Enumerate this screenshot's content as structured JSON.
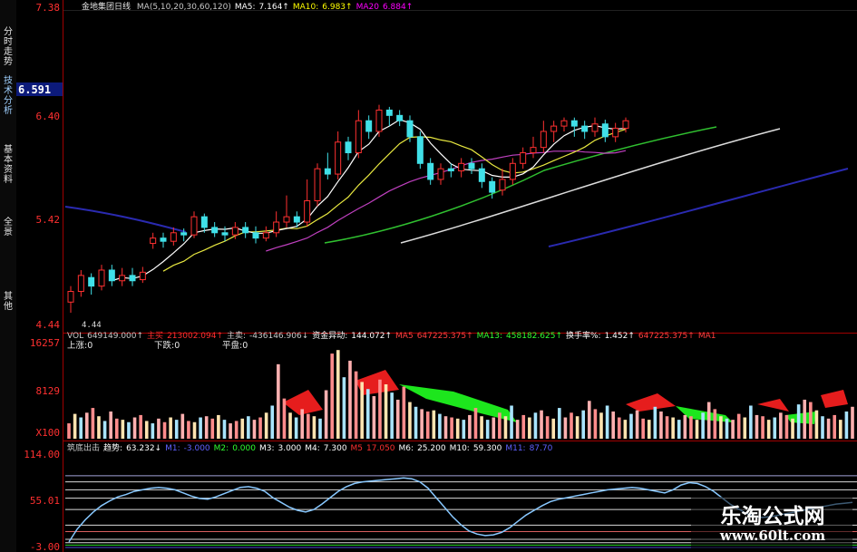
{
  "side_tabs": [
    "分时走势",
    "技术分析",
    "基本资料",
    "全景",
    "其他"
  ],
  "watermark": {
    "line1": "乐淘公式网",
    "line2": "www.60lt.com"
  },
  "chart_data": [
    {
      "type": "candlestick",
      "title": "金地集团日线",
      "legend": [
        {
          "text": "MA(5,10,20,30,60,120)",
          "color": "#c8c8c8"
        },
        {
          "text": "MA5:",
          "color": "#ffffff"
        },
        {
          "text": "7.164↑",
          "color": "#ffffff"
        },
        {
          "text": "MA10:",
          "color": "#ffff00"
        },
        {
          "text": "6.983↑",
          "color": "#ffff00"
        },
        {
          "text": "MA20",
          "color": "#ff00ff"
        },
        {
          "text": "6.884↑",
          "color": "#ff00ff"
        }
      ],
      "y_ticks": [
        "7.38",
        "6.40",
        "5.42",
        "4.44"
      ],
      "ylim": [
        4.44,
        7.38
      ],
      "current_price": "6.591",
      "low_label": "4.44",
      "candles": [
        [
          4.65,
          4.75,
          4.55,
          4.8
        ],
        [
          4.75,
          4.9,
          4.7,
          4.95
        ],
        [
          4.88,
          4.8,
          4.72,
          4.92
        ],
        [
          4.8,
          4.95,
          4.76,
          5.0
        ],
        [
          4.95,
          4.85,
          4.8,
          5.0
        ],
        [
          4.85,
          4.9,
          4.8,
          4.97
        ],
        [
          4.9,
          4.85,
          4.8,
          4.97
        ],
        [
          4.86,
          4.93,
          4.83,
          4.98
        ],
        [
          5.2,
          5.25,
          5.15,
          5.3
        ],
        [
          5.25,
          5.22,
          5.16,
          5.3
        ],
        [
          5.22,
          5.3,
          5.18,
          5.35
        ],
        [
          5.3,
          5.28,
          5.22,
          5.34
        ],
        [
          5.28,
          5.45,
          5.25,
          5.5
        ],
        [
          5.45,
          5.35,
          5.3,
          5.48
        ],
        [
          5.35,
          5.3,
          5.26,
          5.4
        ],
        [
          5.3,
          5.28,
          5.22,
          5.36
        ],
        [
          5.28,
          5.35,
          5.24,
          5.4
        ],
        [
          5.35,
          5.3,
          5.25,
          5.4
        ],
        [
          5.3,
          5.25,
          5.2,
          5.36
        ],
        [
          5.25,
          5.3,
          5.22,
          5.36
        ],
        [
          5.3,
          5.4,
          5.26,
          5.5
        ],
        [
          5.4,
          5.45,
          5.35,
          5.65
        ],
        [
          5.45,
          5.4,
          5.35,
          5.5
        ],
        [
          5.4,
          5.6,
          5.36,
          5.8
        ],
        [
          5.6,
          5.9,
          5.55,
          5.95
        ],
        [
          5.9,
          5.85,
          5.8,
          6.05
        ],
        [
          5.85,
          6.15,
          5.8,
          6.25
        ],
        [
          6.15,
          6.05,
          5.98,
          6.2
        ],
        [
          6.05,
          6.35,
          6.0,
          6.45
        ],
        [
          6.35,
          6.25,
          6.18,
          6.4
        ],
        [
          6.25,
          6.45,
          6.2,
          6.5
        ],
        [
          6.45,
          6.4,
          6.3,
          6.48
        ],
        [
          6.4,
          6.35,
          6.3,
          6.45
        ],
        [
          6.35,
          6.2,
          6.15,
          6.4
        ],
        [
          6.2,
          5.95,
          5.9,
          6.25
        ],
        [
          5.95,
          5.8,
          5.75,
          6.0
        ],
        [
          5.8,
          5.9,
          5.75,
          5.95
        ],
        [
          5.9,
          5.88,
          5.82,
          5.95
        ],
        [
          5.88,
          5.95,
          5.82,
          6.0
        ],
        [
          5.95,
          5.9,
          5.85,
          6.0
        ],
        [
          5.9,
          5.78,
          5.72,
          5.95
        ],
        [
          5.78,
          5.68,
          5.62,
          5.82
        ],
        [
          5.7,
          5.8,
          5.65,
          5.9
        ],
        [
          5.8,
          5.95,
          5.75,
          6.0
        ],
        [
          5.95,
          6.05,
          5.9,
          6.1
        ],
        [
          6.05,
          6.1,
          6.0,
          6.2
        ],
        [
          6.1,
          6.25,
          6.05,
          6.35
        ],
        [
          6.25,
          6.3,
          6.15,
          6.35
        ],
        [
          6.3,
          6.35,
          6.25,
          6.38
        ],
        [
          6.35,
          6.3,
          6.2,
          6.38
        ],
        [
          6.3,
          6.25,
          6.18,
          6.35
        ],
        [
          6.25,
          6.32,
          6.2,
          6.38
        ],
        [
          6.32,
          6.2,
          6.15,
          6.36
        ],
        [
          6.2,
          6.28,
          6.15,
          6.33
        ],
        [
          6.28,
          6.35,
          6.24,
          6.38
        ]
      ]
    },
    {
      "type": "bar",
      "legend": [
        {
          "text": "VOL",
          "color": "#c8c8c8"
        },
        {
          "text": "649149.000↑",
          "color": "#c8c8c8"
        },
        {
          "text": "主买",
          "color": "#ff3030"
        },
        {
          "text": "213002.094↑",
          "color": "#ff3030"
        },
        {
          "text": "主卖:",
          "color": "#c8c8c8"
        },
        {
          "text": "-436146.906↓",
          "color": "#c8c8c8"
        },
        {
          "text": "资金异动:",
          "color": "#ffffff"
        },
        {
          "text": "144.072↑",
          "color": "#ffffff"
        },
        {
          "text": "MA5",
          "color": "#ff4040"
        },
        {
          "text": "647225.375↑",
          "color": "#ff4040"
        },
        {
          "text": "MA13:",
          "color": "#30ff30"
        },
        {
          "text": "458182.625↑",
          "color": "#30ff30"
        },
        {
          "text": "换手率%:",
          "color": "#ffffff"
        },
        {
          "text": "1.452↑",
          "color": "#ffffff"
        },
        {
          "text": "647225.375↑",
          "color": "#ff4040"
        },
        {
          "text": "MA1",
          "color": "#ff4040"
        }
      ],
      "sublegend": [
        "上涨:0",
        "下跌:0",
        "平盘:0"
      ],
      "y_ticks": [
        "16257",
        "8129",
        "X100"
      ],
      "ylim": [
        0,
        16257
      ],
      "values": [
        2600,
        4200,
        3600,
        4400,
        5200,
        3800,
        3000,
        4600,
        3400,
        3200,
        2800,
        3600,
        4000,
        3000,
        2600,
        3400,
        2800,
        3600,
        3200,
        4200,
        3000,
        2800,
        3600,
        3800,
        3400,
        4000,
        3200,
        2600,
        3000,
        3400,
        3800,
        3200,
        3600,
        4400,
        5600,
        12600,
        6800,
        4400,
        3600,
        5000,
        4200,
        3800,
        3400,
        8200,
        14400,
        15000,
        10400,
        13200,
        11400,
        9600,
        8400,
        7200,
        10000,
        9200,
        7800,
        6600,
        8800,
        6200,
        5400,
        5000,
        4600,
        4800,
        4200,
        3800,
        3600,
        3400,
        3200,
        4000,
        5200,
        3800,
        3200,
        3600,
        4400,
        3800,
        5600,
        3200,
        4000,
        3600,
        4400,
        4800,
        3800,
        3400,
        5200,
        3600,
        4400,
        3800,
        4800,
        6400,
        5000,
        4400,
        5600,
        4600,
        3600,
        3200,
        4200,
        4800,
        3400,
        3200,
        5400,
        4600,
        3800,
        3600,
        3200,
        4000,
        3800,
        3200,
        4400,
        6200,
        5000,
        3800,
        3400,
        3200,
        4200,
        3600,
        5600,
        4000,
        3800,
        3200,
        3600,
        4400,
        4000,
        3400,
        5800,
        6600,
        6200,
        4800,
        3800,
        3400,
        4000,
        3200,
        4600,
        5400
      ]
    },
    {
      "type": "line",
      "legend": [
        {
          "text": "筑底出击",
          "color": "#c8c8c8"
        },
        {
          "text": "趋势:",
          "color": "#ffffff"
        },
        {
          "text": "63.232↓",
          "color": "#ffffff"
        },
        {
          "text": "M1:",
          "color": "#6060ff"
        },
        {
          "text": "-3.000",
          "color": "#6060ff"
        },
        {
          "text": "M2:",
          "color": "#30ff30"
        },
        {
          "text": "0.000",
          "color": "#30ff30"
        },
        {
          "text": "M3:",
          "color": "#ffffff"
        },
        {
          "text": "3.000",
          "color": "#ffffff"
        },
        {
          "text": "M4:",
          "color": "#ffffff"
        },
        {
          "text": "7.300",
          "color": "#ffffff"
        },
        {
          "text": "M5",
          "color": "#ff3030"
        },
        {
          "text": "17.050",
          "color": "#ff3030"
        },
        {
          "text": "M6:",
          "color": "#ffffff"
        },
        {
          "text": "25.200",
          "color": "#ffffff"
        },
        {
          "text": "M10:",
          "color": "#ffffff"
        },
        {
          "text": "59.300",
          "color": "#ffffff"
        },
        {
          "text": "M11:",
          "color": "#6060ff"
        },
        {
          "text": "87.70",
          "color": "#6060ff"
        }
      ],
      "y_ticks": [
        "114.00",
        "55.01",
        "-3.00"
      ],
      "ylim": [
        -3,
        114
      ],
      "values": [
        4,
        20,
        32,
        42,
        50,
        56,
        61,
        64,
        68,
        70,
        72,
        73,
        72,
        70,
        66,
        62,
        59,
        58,
        61,
        65,
        69,
        73,
        74,
        72,
        68,
        60,
        54,
        48,
        44,
        42,
        45,
        52,
        60,
        68,
        74,
        78,
        80,
        81,
        82,
        83,
        84,
        85,
        84,
        80,
        72,
        60,
        48,
        36,
        26,
        18,
        14,
        12,
        13,
        16,
        22,
        30,
        38,
        44,
        50,
        55,
        58,
        60,
        62,
        64,
        66,
        68,
        70,
        71,
        72,
        73,
        72,
        70,
        68,
        66,
        70,
        76,
        79,
        78,
        74,
        68,
        60,
        52,
        46,
        40,
        36,
        35,
        36,
        38,
        40,
        42,
        44,
        46,
        48,
        50,
        52,
        53,
        54
      ]
    }
  ]
}
